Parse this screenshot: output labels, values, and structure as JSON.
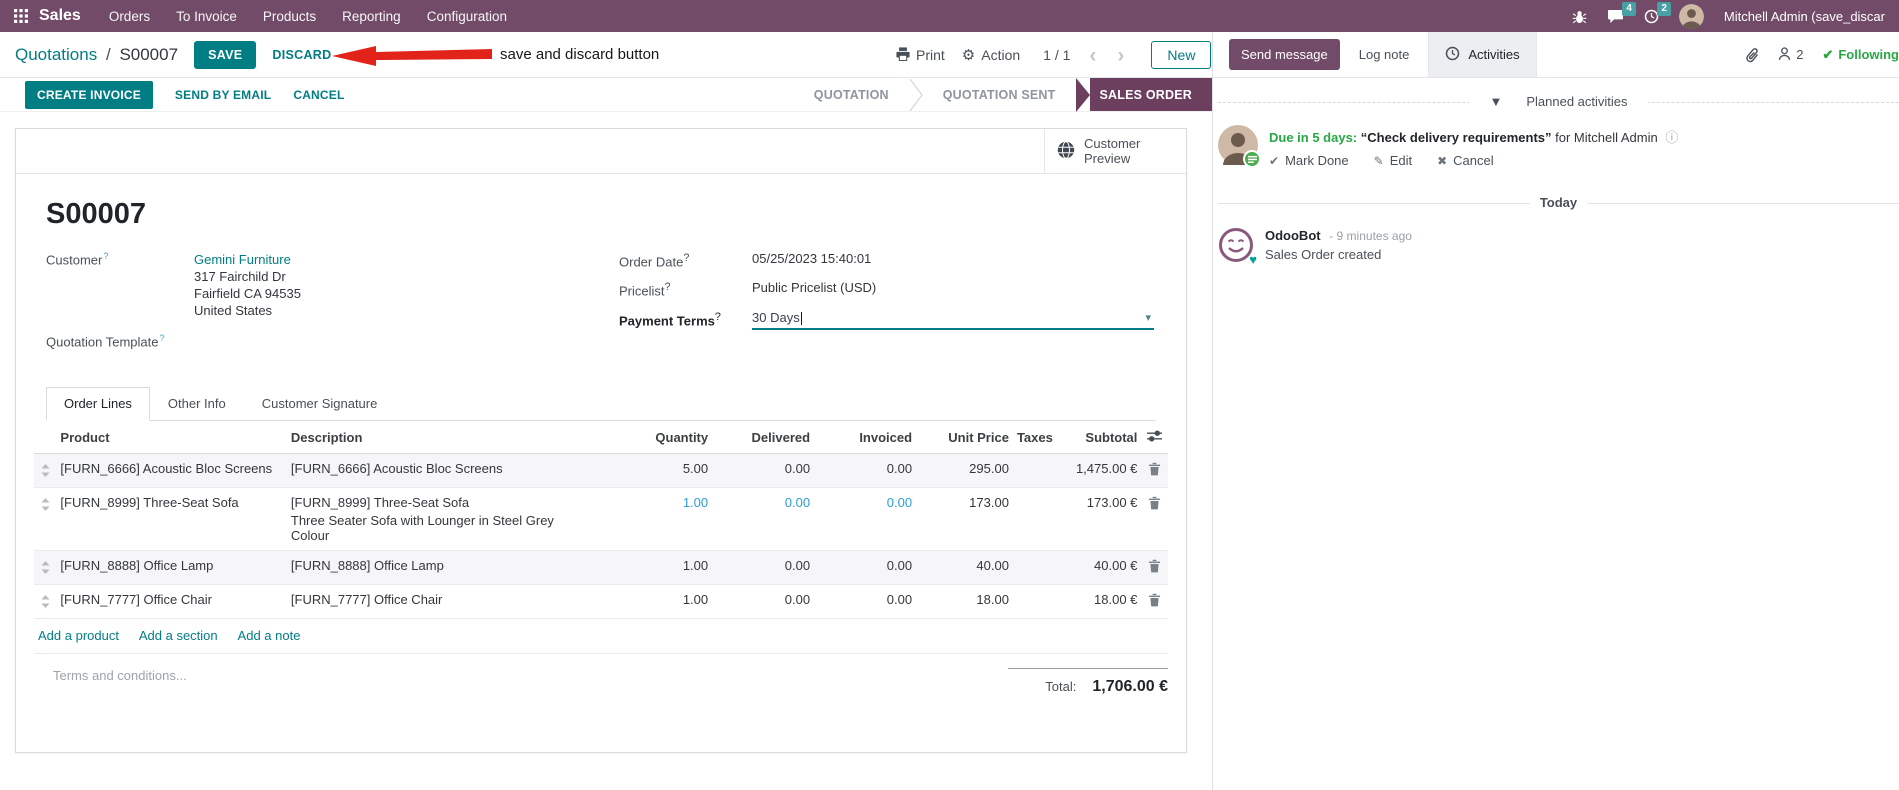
{
  "colors": {
    "brand_purple": "#714B67",
    "accent_teal": "#017e84",
    "stage_active_bg": "#6d3f5f",
    "highlight_blue": "#2a9ed5",
    "badge_teal": "#46a0a5",
    "activity_green": "#28a745",
    "annotation_red": "#e2231a"
  },
  "topnav": {
    "brand": "Sales",
    "menus": [
      "Orders",
      "To Invoice",
      "Products",
      "Reporting",
      "Configuration"
    ],
    "messages_badge": "4",
    "activities_badge": "2",
    "user": "Mitchell Admin (save_discar"
  },
  "control_panel": {
    "breadcrumb_parent": "Quotations",
    "breadcrumb_sep": "/",
    "breadcrumb_current": "S00007",
    "save": "SAVE",
    "discard": "DISCARD",
    "annotation": "save and discard button",
    "print": "Print",
    "action": "Action",
    "pager": "1 / 1",
    "new": "New"
  },
  "statusbar": {
    "create_invoice": "CREATE INVOICE",
    "send_by_email": "SEND BY EMAIL",
    "cancel": "CANCEL",
    "stages": [
      "QUOTATION",
      "QUOTATION SENT",
      "SALES ORDER"
    ]
  },
  "sheet": {
    "preview": "Customer Preview",
    "name": "S00007",
    "fields": {
      "customer_label": "Customer",
      "customer": "Gemini Furniture",
      "address": [
        "317 Fairchild Dr",
        "Fairfield CA 94535",
        "United States"
      ],
      "quotation_template_label": "Quotation Template",
      "order_date_label": "Order Date",
      "order_date": "05/25/2023 15:40:01",
      "pricelist_label": "Pricelist",
      "pricelist": "Public Pricelist (USD)",
      "payment_terms_label": "Payment Terms",
      "payment_terms": "30 Days"
    },
    "tabs": [
      "Order Lines",
      "Other Info",
      "Customer Signature"
    ],
    "table": {
      "headers": {
        "product": "Product",
        "description": "Description",
        "quantity": "Quantity",
        "delivered": "Delivered",
        "invoiced": "Invoiced",
        "unit_price": "Unit Price",
        "taxes": "Taxes",
        "subtotal": "Subtotal"
      },
      "rows": [
        {
          "product": "[FURN_6666] Acoustic Bloc Screens",
          "description": "[FURN_6666] Acoustic Bloc Screens",
          "description2": "",
          "quantity": "5.00",
          "delivered": "0.00",
          "invoiced": "0.00",
          "unit_price": "295.00",
          "taxes": "",
          "subtotal": "1,475.00 €"
        },
        {
          "product": "[FURN_8999] Three-Seat Sofa",
          "description": "[FURN_8999] Three-Seat Sofa",
          "description2": "Three Seater Sofa with Lounger in Steel Grey Colour",
          "quantity": "1.00",
          "delivered": "0.00",
          "invoiced": "0.00",
          "unit_price": "173.00",
          "taxes": "",
          "subtotal": "173.00 €"
        },
        {
          "product": "[FURN_8888] Office Lamp",
          "description": "[FURN_8888] Office Lamp",
          "description2": "",
          "quantity": "1.00",
          "delivered": "0.00",
          "invoiced": "0.00",
          "unit_price": "40.00",
          "taxes": "",
          "subtotal": "40.00 €"
        },
        {
          "product": "[FURN_7777] Office Chair",
          "description": "[FURN_7777] Office Chair",
          "description2": "",
          "quantity": "1.00",
          "delivered": "0.00",
          "invoiced": "0.00",
          "unit_price": "18.00",
          "taxes": "",
          "subtotal": "18.00 €"
        }
      ],
      "footer_links": [
        "Add a product",
        "Add a section",
        "Add a note"
      ]
    },
    "terms_placeholder": "Terms and conditions...",
    "total_label": "Total:",
    "total_value": "1,706.00 €"
  },
  "chatter": {
    "send_message": "Send message",
    "log_note": "Log note",
    "activities_tab": "Activities",
    "followers_count": "2",
    "following": "Following",
    "planned_header": "Planned activities",
    "activity": {
      "due": "Due in 5 days:",
      "summary": "“Check delivery requirements”",
      "for_text": "for Mitchell Admin",
      "mark_done": "Mark Done",
      "edit": "Edit",
      "cancel": "Cancel"
    },
    "today": "Today",
    "message": {
      "author": "OdooBot",
      "time": "- 9 minutes ago",
      "body": "Sales Order created"
    }
  }
}
